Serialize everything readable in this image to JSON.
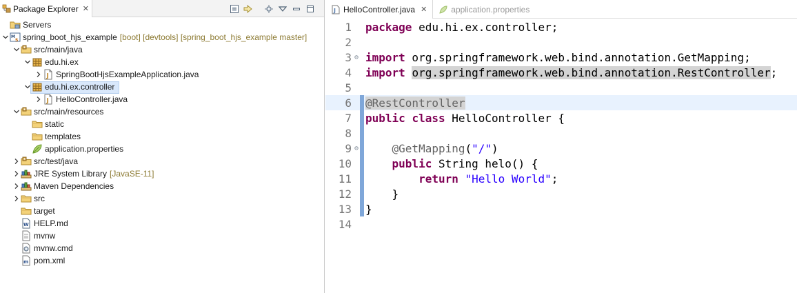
{
  "explorer": {
    "title": "Package Explorer",
    "close_glyph": "✕",
    "toolbar": [
      "collapse-all-icon",
      "link-with-editor-icon",
      "filters-icon",
      "view-menu-icon",
      "minimize-icon",
      "maximize-icon"
    ],
    "rows": [
      {
        "level": 0,
        "twisty": "none",
        "icon": "servers-folder-icon",
        "label": "Servers",
        "deco": ""
      },
      {
        "level": 0,
        "twisty": "open",
        "icon": "maven-project-icon",
        "label": "spring_boot_hjs_example",
        "deco": "[boot] [devtools] [spring_boot_hjs_example master]"
      },
      {
        "level": 1,
        "twisty": "open",
        "icon": "source-folder-icon",
        "label": "src/main/java",
        "deco": ""
      },
      {
        "level": 2,
        "twisty": "open",
        "icon": "package-icon",
        "label": "edu.hi.ex",
        "deco": ""
      },
      {
        "level": 3,
        "twisty": "closed",
        "icon": "java-file-icon",
        "label": "SpringBootHjsExampleApplication.java",
        "deco": ""
      },
      {
        "level": 2,
        "twisty": "open",
        "icon": "package-icon",
        "label": "edu.hi.ex.controller",
        "deco": "",
        "selected": true
      },
      {
        "level": 3,
        "twisty": "closed",
        "icon": "java-file-icon",
        "label": "HelloController.java",
        "deco": ""
      },
      {
        "level": 1,
        "twisty": "open",
        "icon": "source-folder-icon",
        "label": "src/main/resources",
        "deco": ""
      },
      {
        "level": 2,
        "twisty": "none",
        "icon": "folder-icon",
        "label": "static",
        "deco": ""
      },
      {
        "level": 2,
        "twisty": "none",
        "icon": "folder-icon",
        "label": "templates",
        "deco": ""
      },
      {
        "level": 2,
        "twisty": "none",
        "icon": "properties-file-icon",
        "label": "application.properties",
        "deco": ""
      },
      {
        "level": 1,
        "twisty": "closed",
        "icon": "source-folder-icon",
        "label": "src/test/java",
        "deco": ""
      },
      {
        "level": 1,
        "twisty": "closed",
        "icon": "library-icon",
        "label": "JRE System Library",
        "deco": "[JavaSE-11]"
      },
      {
        "level": 1,
        "twisty": "closed",
        "icon": "library-icon",
        "label": "Maven Dependencies",
        "deco": ""
      },
      {
        "level": 1,
        "twisty": "closed",
        "icon": "folder-icon",
        "label": "src",
        "deco": ""
      },
      {
        "level": 1,
        "twisty": "none",
        "icon": "folder-icon",
        "label": "target",
        "deco": ""
      },
      {
        "level": 1,
        "twisty": "none",
        "icon": "markdown-file-icon",
        "label": "HELP.md",
        "deco": ""
      },
      {
        "level": 1,
        "twisty": "none",
        "icon": "text-file-icon",
        "label": "mvnw",
        "deco": ""
      },
      {
        "level": 1,
        "twisty": "none",
        "icon": "cmd-file-icon",
        "label": "mvnw.cmd",
        "deco": ""
      },
      {
        "level": 1,
        "twisty": "none",
        "icon": "xml-file-icon",
        "label": "pom.xml",
        "deco": ""
      }
    ]
  },
  "editor": {
    "tabs": [
      {
        "label": "HelloController.java",
        "active": true,
        "close_glyph": "✕",
        "icon": "java-file-icon"
      },
      {
        "label": "application.properties",
        "active": false,
        "icon": "properties-file-icon"
      }
    ],
    "lines": [
      {
        "n": "1",
        "fold": "",
        "bar": false,
        "hl": false,
        "segments": [
          {
            "t": "package",
            "c": "kw"
          },
          {
            "t": " edu.hi.ex.controller;",
            "c": ""
          }
        ]
      },
      {
        "n": "2",
        "fold": "",
        "bar": false,
        "hl": false,
        "segments": []
      },
      {
        "n": "3",
        "fold": "⊖",
        "bar": false,
        "hl": false,
        "segments": [
          {
            "t": "import",
            "c": "kw"
          },
          {
            "t": " org.springframework.web.bind.annotation.GetMapping;",
            "c": ""
          }
        ]
      },
      {
        "n": "4",
        "fold": "",
        "bar": false,
        "hl": false,
        "segments": [
          {
            "t": "import",
            "c": "kw"
          },
          {
            "t": " ",
            "c": ""
          },
          {
            "t": "org.springframework.web.bind.annotation.RestController",
            "c": "occ"
          },
          {
            "t": ";",
            "c": ""
          }
        ]
      },
      {
        "n": "5",
        "fold": "",
        "bar": false,
        "hl": false,
        "segments": []
      },
      {
        "n": "6",
        "fold": "",
        "bar": true,
        "hl": true,
        "segments": [
          {
            "t": "@RestController",
            "c": "ann ann-hl"
          }
        ]
      },
      {
        "n": "7",
        "fold": "",
        "bar": true,
        "hl": false,
        "segments": [
          {
            "t": "public",
            "c": "kw"
          },
          {
            "t": " ",
            "c": ""
          },
          {
            "t": "class",
            "c": "kw"
          },
          {
            "t": " HelloController {",
            "c": ""
          }
        ]
      },
      {
        "n": "8",
        "fold": "",
        "bar": true,
        "hl": false,
        "segments": []
      },
      {
        "n": "9",
        "fold": "⊖",
        "bar": true,
        "hl": false,
        "segments": [
          {
            "t": "    ",
            "c": ""
          },
          {
            "t": "@GetMapping",
            "c": "ann"
          },
          {
            "t": "(",
            "c": ""
          },
          {
            "t": "\"/\"",
            "c": "str"
          },
          {
            "t": ")",
            "c": ""
          }
        ]
      },
      {
        "n": "10",
        "fold": "",
        "bar": true,
        "hl": false,
        "segments": [
          {
            "t": "    ",
            "c": ""
          },
          {
            "t": "public",
            "c": "kw"
          },
          {
            "t": " String helo() {",
            "c": ""
          }
        ]
      },
      {
        "n": "11",
        "fold": "",
        "bar": true,
        "hl": false,
        "segments": [
          {
            "t": "        ",
            "c": ""
          },
          {
            "t": "return",
            "c": "kw"
          },
          {
            "t": " ",
            "c": ""
          },
          {
            "t": "\"Hello World\"",
            "c": "str"
          },
          {
            "t": ";",
            "c": ""
          }
        ]
      },
      {
        "n": "12",
        "fold": "",
        "bar": true,
        "hl": false,
        "segments": [
          {
            "t": "    }",
            "c": ""
          }
        ]
      },
      {
        "n": "13",
        "fold": "",
        "bar": true,
        "hl": false,
        "segments": [
          {
            "t": "}",
            "c": ""
          }
        ]
      },
      {
        "n": "14",
        "fold": "",
        "bar": false,
        "hl": false,
        "segments": []
      }
    ]
  },
  "colors": {
    "keyword": "#7f0055",
    "annotation": "#646464",
    "string": "#2a00ff",
    "selection": "#d9e8fb",
    "current_line": "#e8f2fe",
    "change_bar": "#7fa7d9",
    "decoration": "#8c7a32"
  }
}
